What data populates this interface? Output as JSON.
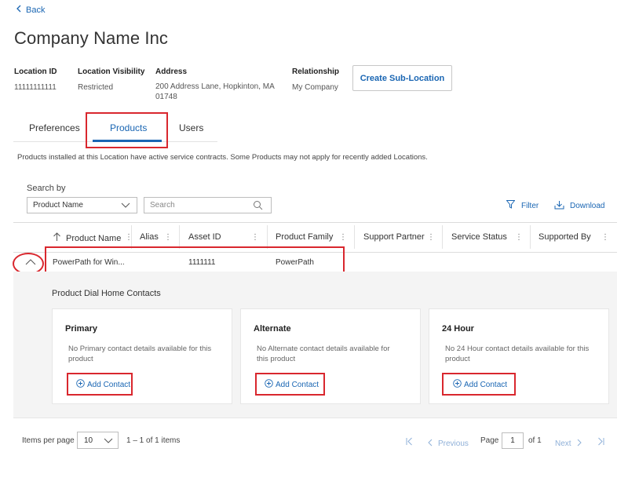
{
  "nav": {
    "back_label": "Back"
  },
  "company": {
    "title": "Company Name Inc"
  },
  "info": {
    "location_id_label": "Location ID",
    "location_id_value": "11111111111",
    "visibility_label": "Location Visibility",
    "visibility_value": "Restricted",
    "address_label": "Address",
    "address_line1": "200 Address Lane, Hopkinton, MA",
    "address_line2": "01748",
    "relationship_label": "Relationship",
    "relationship_value": "My Company",
    "create_sublocation_label": "Create Sub-Location"
  },
  "tabs": [
    {
      "label": "Preferences"
    },
    {
      "label": "Products"
    },
    {
      "label": "Users"
    }
  ],
  "description": "Products installed at this Location have active service contracts. Some Products may not apply for recently added Locations.",
  "search": {
    "search_by_label": "Search by",
    "field_selected": "Product Name",
    "placeholder": "Search",
    "filter_label": "Filter",
    "download_label": "Download"
  },
  "table": {
    "columns": [
      "Product Name",
      "Alias",
      "Asset ID",
      "Product Family",
      "Support Partner",
      "Service Status",
      "Supported By"
    ],
    "rows": [
      {
        "product_name": "PowerPath for Win...",
        "alias": "",
        "asset_id": "1111111",
        "product_family": "PowerPath"
      }
    ]
  },
  "dial_home": {
    "title": "Product Dial Home Contacts",
    "cards": [
      {
        "title": "Primary",
        "text_line1": "No Primary contact details available for this",
        "text_line2": "product",
        "add_label": "Add Contact"
      },
      {
        "title": "Alternate",
        "text_line1": "No Alternate contact details available for",
        "text_line2": "this product",
        "add_label": "Add Contact"
      },
      {
        "title": "24 Hour",
        "text_line1": "No 24 Hour contact details available for this",
        "text_line2": "product",
        "add_label": "Add Contact"
      }
    ]
  },
  "pagination": {
    "items_per_page_label": "Items per page",
    "items_per_page_value": "10",
    "range_text": "1 – 1 of 1 items",
    "previous_label": "Previous",
    "page_label": "Page",
    "page_value": "1",
    "of_label": "of 1",
    "next_label": "Next"
  },
  "colors": {
    "accent": "#1a66b3",
    "highlight_red": "#d9272e"
  }
}
